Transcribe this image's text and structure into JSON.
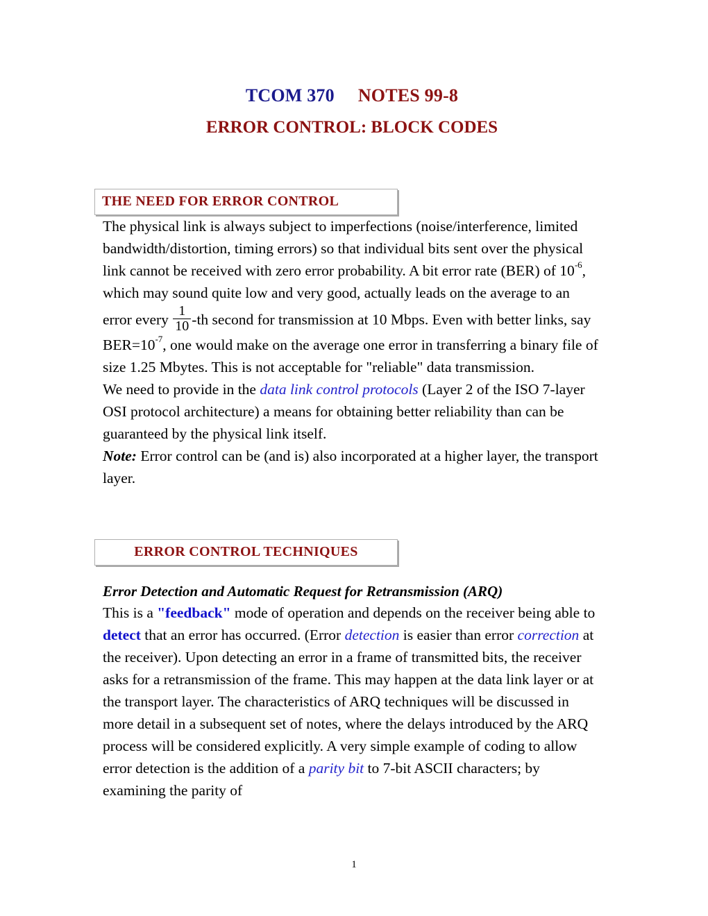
{
  "document": {
    "title": {
      "course": "TCOM 370",
      "notes": "NOTES 99-8",
      "subtitle": "ERROR CONTROL:  BLOCK CODES"
    },
    "page_number": "1"
  },
  "sections": [
    {
      "heading": "THE NEED FOR ERROR CONTROL",
      "paragraphs": {
        "intro_part1": "The physical link is always subject to imperfections (noise/interference, limited bandwidth/distortion, timing errors) so that individual bits sent over the physical link cannot be received with zero error probability.  A bit error rate (BER) of 10",
        "intro_sup1": "-6",
        "intro_part2": ", which may sound quite low and very good, actually leads on the average to an error every ",
        "frac_numerator": "1",
        "frac_denominator": "10",
        "intro_part3": "-th second for transmission at 10 Mbps. Even with better links, say BER=10",
        "intro_sup2": "-7",
        "intro_part4": ", one would make on the average one error in transferring a binary file of size 1.25 Mbytes.  This is not acceptable for \"reliable\" data transmission.",
        "need_part1": "We need to provide in the ",
        "need_emph": "data link control protocols",
        "need_part2": "  (Layer 2 of the ISO 7-layer OSI protocol architecture) a means for obtaining better reliability than can be guaranteed by the physical link itself.",
        "note_label": "Note:",
        "note_text": "  Error control can be (and is) also incorporated at a higher layer, the transport layer."
      }
    },
    {
      "heading": "ERROR CONTROL TECHNIQUES",
      "subheading": "Error Detection and Automatic Request for Retransmission (ARQ)",
      "paragraphs": {
        "arq_part1": "This is a ",
        "arq_feedback": "\"feedback\"",
        "arq_part2": " mode of operation and depends on the receiver being able to ",
        "arq_detect": "detect",
        "arq_part3": " that an error has occurred. (Error ",
        "arq_detection": "detection",
        "arq_part4": " is easier than error ",
        "arq_correction": "correction",
        "arq_part5": " at the receiver).  Upon detecting an error in a frame of transmitted bits, the receiver asks for a retransmission of the frame.  This may happen at the data link layer or at the transport layer.  The characteristics of ARQ techniques will be discussed in more detail in a subsequent set of notes, where the delays introduced by the ARQ process will be considered explicitly.   A very simple example of coding to allow error detection is the addition of a ",
        "arq_parity": "parity bit",
        "arq_part6": " to 7-bit ASCII characters; by examining the parity of"
      }
    }
  ],
  "colors": {
    "title_blue": "#1a1a8c",
    "title_red": "#8c1212",
    "heading_red": "#8c1212",
    "emphasis_blue": "#2222cc",
    "box_border": "#b0b0b0"
  }
}
